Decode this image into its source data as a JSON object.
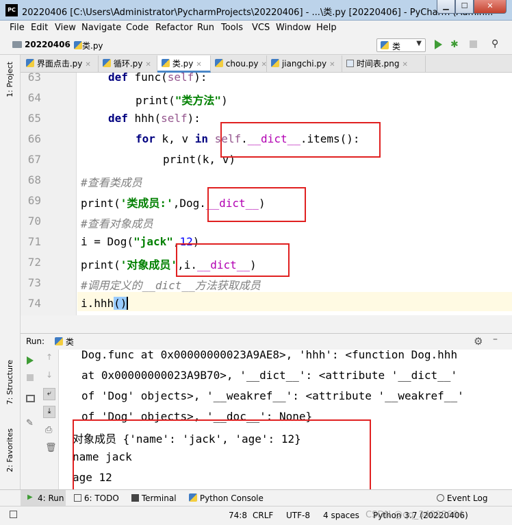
{
  "window": {
    "app_icon": "PC",
    "title": "20220406 [C:\\Users\\Administrator\\PycharmProjects\\20220406] - ...\\类.py [20220406] - PyCharm (Admin..."
  },
  "menu": [
    "File",
    "Edit",
    "View",
    "Navigate",
    "Code",
    "Refactor",
    "Run",
    "Tools",
    "VCS",
    "Window",
    "Help"
  ],
  "navbar": {
    "project": "20220406",
    "file": "类.py",
    "run_config": "类"
  },
  "left_tool_tabs": [
    "1: Project",
    "7: Structure",
    "2: Favorites"
  ],
  "editor_tabs": [
    {
      "label": "界面点击.py",
      "active": false
    },
    {
      "label": "循环.py",
      "active": false
    },
    {
      "label": "类.py",
      "active": true
    },
    {
      "label": "chou.py",
      "active": false
    },
    {
      "label": "jiangchi.py",
      "active": false
    },
    {
      "label": "时间表.png",
      "active": false
    }
  ],
  "editor": {
    "line_numbers": [
      "63",
      "64",
      "65",
      "66",
      "67",
      "68",
      "69",
      "70",
      "71",
      "72",
      "73",
      "74"
    ],
    "line63": {
      "kw": "def",
      "name": " func(",
      "self": "self",
      "end": "):"
    },
    "line64": {
      "fn": "print(",
      "str": "\"类方法\"",
      "end": ")"
    },
    "line65": {
      "kw": "def",
      "name": " hhh(",
      "self": "self",
      "end": "):"
    },
    "line66": {
      "kw_for": "for",
      "vars": " k, v ",
      "kw_in": "in",
      "sp": " ",
      "self": "self",
      "dot": ".",
      "dunder": "__dict__",
      "end": ".items():"
    },
    "line67": {
      "text": "print(k, v)"
    },
    "line68": {
      "comment": "#查看类成员"
    },
    "line69": {
      "fn": "print(",
      "str": "'类成员:'",
      "mid": ",Dog.",
      "dunder": "__dict__",
      "end": ")"
    },
    "line70": {
      "comment": "#查看对象成员"
    },
    "line71": {
      "start": "i = Dog(",
      "str": "\"jack\"",
      "comma": ",",
      "num": "12",
      "end": ")"
    },
    "line72": {
      "fn": "print(",
      "str": "'对象成员'",
      "mid": ",i.",
      "dunder": "__dict__",
      "end": ")"
    },
    "line73": {
      "comment": "#调用定义的__dict__方法获取成员"
    },
    "line74": {
      "text": "i.hhh",
      "paren": "()"
    }
  },
  "run_panel": {
    "label": "Run:",
    "config": "类"
  },
  "console_lines": [
    "Dog.func at 0x00000000023A9AE8>, 'hhh': <function Dog.hhh",
    "at 0x00000000023A9B70>, '__dict__': <attribute '__dict__'",
    "of 'Dog' objects>, '__weakref__': <attribute '__weakref__'",
    "of 'Dog' objects>, '__doc__': None}",
    "对象成员 {'name': 'jack', 'age': 12}",
    "name jack",
    "age 12"
  ],
  "bottom_tabs": [
    "4: Run",
    "6: TODO",
    "Terminal",
    "Python Console",
    "Event Log"
  ],
  "status": {
    "position": "74:8",
    "line_sep": "CRLF",
    "encoding": "UTF-8",
    "indent": "4 spaces",
    "interpreter": "Python 3.7 (20220406)",
    "watermark": "CSDN @qq_34098664"
  },
  "colors": {
    "keyword": "#000080",
    "string": "#008000",
    "dunder": "#b200b2",
    "self": "#94558d",
    "comment": "#808080",
    "number": "#0000ff",
    "highlight_box": "#e02020"
  },
  "icons": [
    "run-icon",
    "debug-icon",
    "stop-icon",
    "search-icon",
    "gear-icon",
    "minimize-icon"
  ]
}
